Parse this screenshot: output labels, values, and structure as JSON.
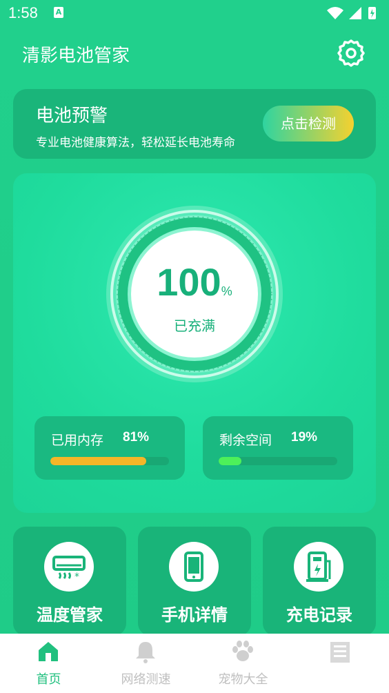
{
  "status_bar": {
    "time": "1:58",
    "notification_icon": "A"
  },
  "app": {
    "title": "清影电池管家"
  },
  "alert": {
    "title": "电池预警",
    "subtitle": "专业电池健康算法，轻松延长电池寿命",
    "button_label": "点击检测"
  },
  "battery": {
    "percent": "100",
    "unit": "%",
    "status": "已充满"
  },
  "stats": [
    {
      "label": "已用内存",
      "value": "81%",
      "fill": 0.81,
      "color": "#f5b628"
    },
    {
      "label": "剩余空间",
      "value": "19%",
      "fill": 0.19,
      "color": "#4df05a"
    }
  ],
  "tiles": [
    {
      "label": "温度管家",
      "icon": "air-conditioner-icon"
    },
    {
      "label": "手机详情",
      "icon": "phone-icon"
    },
    {
      "label": "充电记录",
      "icon": "charger-icon"
    }
  ],
  "tabs": [
    {
      "label": "首页",
      "icon": "home-icon",
      "active": true
    },
    {
      "label": "网络测速",
      "icon": "bell-icon",
      "active": false
    },
    {
      "label": "宠物大全",
      "icon": "paw-icon",
      "active": false
    },
    {
      "label": "",
      "icon": "book-icon",
      "active": false
    }
  ],
  "colors": {
    "accent": "#21c07f",
    "background": "#1fcc88"
  }
}
